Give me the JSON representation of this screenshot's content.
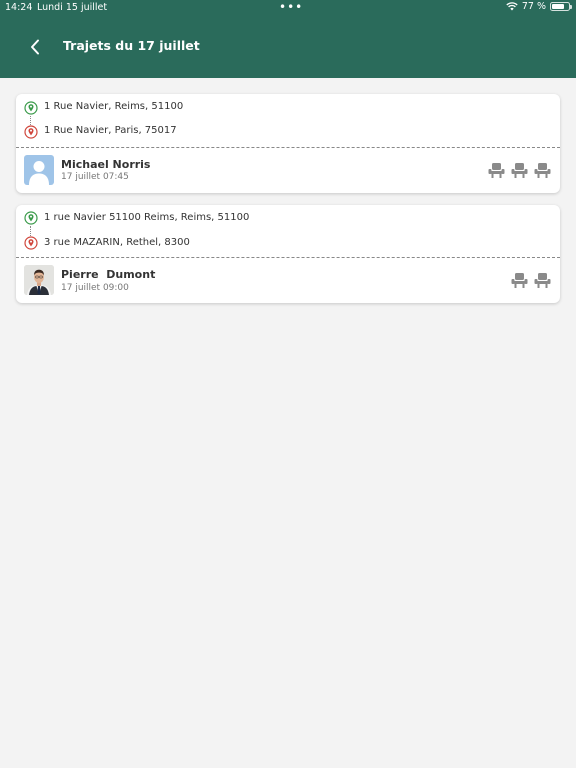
{
  "status": {
    "time": "14:24",
    "date": "Lundi 15 juillet",
    "battery": "77 %",
    "battery_level": 0.77,
    "dots": "•••"
  },
  "header": {
    "title": "Trajets du 17 juillet",
    "background": "#2a6b5b"
  },
  "trips": [
    {
      "from": "1 Rue Navier, Reims, 51100",
      "to": "1 Rue Navier, Paris, 75017",
      "driver": "Michael Norris",
      "datetime": "17 juillet 07:45",
      "seats": 3
    },
    {
      "from": "1 rue Navier 51100 Reims, Reims, 51100",
      "to": "3 rue MAZARIN, Rethel, 8300",
      "driver": "Pierre  Dumont",
      "datetime": "17 juillet 09:00",
      "seats": 2
    }
  ],
  "colors": {
    "origin_pin": "#3a9a4a",
    "destination_pin": "#d0463c",
    "seat_icon": "#8a8a8a"
  },
  "icons": {
    "back": "chevron-left-icon",
    "wifi": "wifi-icon",
    "battery": "battery-icon",
    "origin": "location-pin-green-icon",
    "destination": "location-pin-red-icon",
    "seat": "car-seat-icon",
    "avatar_placeholder": "user-avatar-icon"
  }
}
